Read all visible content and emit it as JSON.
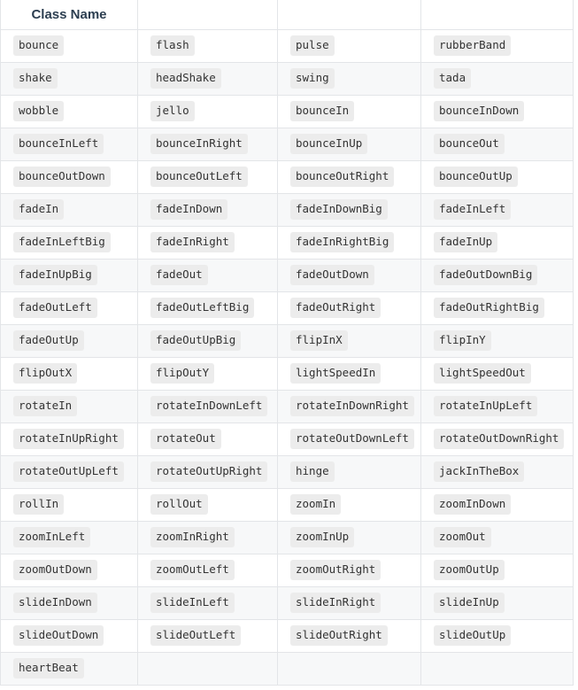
{
  "table": {
    "columns": [
      {
        "label": "Class Name",
        "align": "center"
      },
      {
        "label": "",
        "align": "left"
      },
      {
        "label": "",
        "align": "left"
      },
      {
        "label": "",
        "align": "left"
      }
    ],
    "rows": [
      [
        "bounce",
        "flash",
        "pulse",
        "rubberBand"
      ],
      [
        "shake",
        "headShake",
        "swing",
        "tada"
      ],
      [
        "wobble",
        "jello",
        "bounceIn",
        "bounceInDown"
      ],
      [
        "bounceInLeft",
        "bounceInRight",
        "bounceInUp",
        "bounceOut"
      ],
      [
        "bounceOutDown",
        "bounceOutLeft",
        "bounceOutRight",
        "bounceOutUp"
      ],
      [
        "fadeIn",
        "fadeInDown",
        "fadeInDownBig",
        "fadeInLeft"
      ],
      [
        "fadeInLeftBig",
        "fadeInRight",
        "fadeInRightBig",
        "fadeInUp"
      ],
      [
        "fadeInUpBig",
        "fadeOut",
        "fadeOutDown",
        "fadeOutDownBig"
      ],
      [
        "fadeOutLeft",
        "fadeOutLeftBig",
        "fadeOutRight",
        "fadeOutRightBig"
      ],
      [
        "fadeOutUp",
        "fadeOutUpBig",
        "flipInX",
        "flipInY"
      ],
      [
        "flipOutX",
        "flipOutY",
        "lightSpeedIn",
        "lightSpeedOut"
      ],
      [
        "rotateIn",
        "rotateInDownLeft",
        "rotateInDownRight",
        "rotateInUpLeft"
      ],
      [
        "rotateInUpRight",
        "rotateOut",
        "rotateOutDownLeft",
        "rotateOutDownRight"
      ],
      [
        "rotateOutUpLeft",
        "rotateOutUpRight",
        "hinge",
        "jackInTheBox"
      ],
      [
        "rollIn",
        "rollOut",
        "zoomIn",
        "zoomInDown"
      ],
      [
        "zoomInLeft",
        "zoomInRight",
        "zoomInUp",
        "zoomOut"
      ],
      [
        "zoomOutDown",
        "zoomOutLeft",
        "zoomOutRight",
        "zoomOutUp"
      ],
      [
        "slideInDown",
        "slideInLeft",
        "slideInRight",
        "slideInUp"
      ],
      [
        "slideOutDown",
        "slideOutLeft",
        "slideOutRight",
        "slideOutUp"
      ],
      [
        "heartBeat",
        "",
        "",
        ""
      ]
    ]
  },
  "style": {
    "header_text_color": "#2c3e50",
    "border_color": "#e3e5e8",
    "stripe_background": "#f7f8f9",
    "chip_background": "#ececec",
    "chip_text_color": "#333333",
    "page_background": "#ffffff"
  }
}
